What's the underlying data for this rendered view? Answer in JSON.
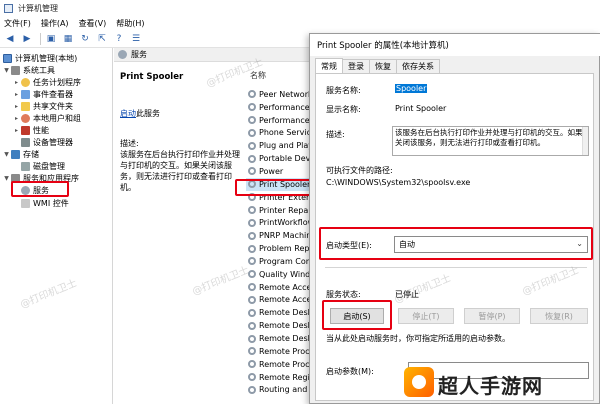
{
  "main_window": {
    "title": "计算机管理",
    "menu": [
      "文件(F)",
      "操作(A)",
      "查看(V)",
      "帮助(H)"
    ]
  },
  "tree": [
    {
      "label": "计算机管理(本地)"
    },
    {
      "label": "系统工具"
    },
    {
      "label": "任务计划程序"
    },
    {
      "label": "事件查看器"
    },
    {
      "label": "共享文件夹"
    },
    {
      "label": "本地用户和组"
    },
    {
      "label": "性能"
    },
    {
      "label": "设备管理器"
    },
    {
      "label": "存储"
    },
    {
      "label": "磁盘管理"
    },
    {
      "label": "服务和应用程序"
    },
    {
      "label": "服务"
    },
    {
      "label": "WMI 控件"
    }
  ],
  "services_pane": {
    "header": "服务",
    "selected_name": "Print Spooler",
    "action_link": "启动",
    "action_suffix": "此服务",
    "desc_label": "描述:",
    "description": "该服务在后台执行打印作业并处理与打印机的交互。如果关闭该服务，则无法进行打印或查看打印机。",
    "column_header": "名称",
    "rows": [
      "Peer Network",
      "Performance C",
      "Performance",
      "Phone Service",
      "Plug and Play",
      "Portable Devi",
      "Power",
      "Print Spooler",
      "Printer Extensi",
      "Printer Repair",
      "PrintWorkflow",
      "PNRP Machine",
      "Problem Repor",
      "Program Comp",
      "Quality Windo",
      "Remote Access",
      "Remote Access",
      "Remote Deskt",
      "Remote Deskt",
      "Remote Deskt",
      "Remote Proce",
      "Remote Proce",
      "Remote Regis",
      "Routing and R"
    ]
  },
  "dialog": {
    "title": "Print Spooler 的属性(本地计算机)",
    "tabs": [
      "常规",
      "登录",
      "恢复",
      "依存关系"
    ],
    "labels": {
      "service_name": "服务名称:",
      "display_name": "显示名称:",
      "description": "描述:",
      "exe_path": "可执行文件的路径:",
      "startup_type": "启动类型(E):",
      "service_status": "服务状态:",
      "hint": "当从此处启动服务时，你可指定所适用的启动参数。",
      "start_params": "启动参数(M):"
    },
    "values": {
      "service_name": "Spooler",
      "display_name": "Print Spooler",
      "description": "该服务在后台执行打印作业并处理与打印机的交互。如果关闭该服务，则无法进行打印或查看打印机。",
      "exe_path": "C:\\WINDOWS\\System32\\spoolsv.exe",
      "startup_type": "自动",
      "service_status": "已停止"
    },
    "buttons": {
      "start": "启动(S)",
      "stop": "停止(T)",
      "pause": "暂停(P)",
      "resume": "恢复(R)"
    }
  },
  "watermark_text": "@打印机卫士",
  "logo_text": "超人手游网",
  "colors": {
    "highlight_red": "#e60012",
    "selection_blue": "#0078d7"
  }
}
